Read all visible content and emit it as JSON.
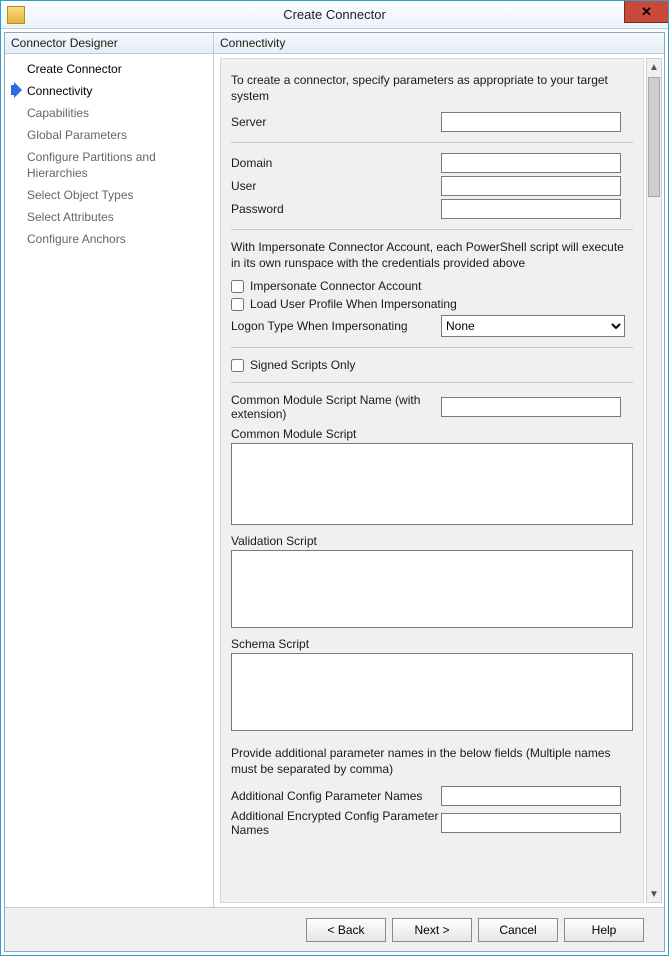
{
  "window": {
    "title": "Create Connector"
  },
  "sidebar": {
    "header": "Connector Designer",
    "items": [
      {
        "label": "Create Connector"
      },
      {
        "label": "Connectivity"
      },
      {
        "label": "Capabilities"
      },
      {
        "label": "Global Parameters"
      },
      {
        "label": "Configure Partitions and Hierarchies"
      },
      {
        "label": "Select Object Types"
      },
      {
        "label": "Select Attributes"
      },
      {
        "label": "Configure Anchors"
      }
    ]
  },
  "main": {
    "header": "Connectivity",
    "intro": "To create a connector, specify parameters as appropriate to your target system",
    "labels": {
      "server": "Server",
      "domain": "Domain",
      "user": "User",
      "password": "Password",
      "impersonateInfo": "With Impersonate Connector Account, each PowerShell script will execute in its own runspace with the credentials provided above",
      "impersonate": "Impersonate Connector Account",
      "loadProfile": "Load User Profile When Impersonating",
      "logonType": "Logon Type When Impersonating",
      "signedOnly": "Signed Scripts Only",
      "commonModuleName": "Common Module Script Name (with extension)",
      "commonModuleScript": "Common Module Script",
      "validationScript": "Validation Script",
      "schemaScript": "Schema Script",
      "additionalInfo": "Provide additional parameter names in the below fields (Multiple names must be separated by comma)",
      "addConfigParams": "Additional Config Parameter Names",
      "addEncConfigParams": "Additional Encrypted Config Parameter Names"
    },
    "values": {
      "server": "",
      "domain": "",
      "user": "",
      "password": "",
      "logonType": "None",
      "commonModuleName": "",
      "addConfigParams": "",
      "addEncConfigParams": ""
    },
    "logonOptions": [
      "None"
    ]
  },
  "buttons": {
    "back": "<  Back",
    "next": "Next  >",
    "cancel": "Cancel",
    "help": "Help"
  }
}
